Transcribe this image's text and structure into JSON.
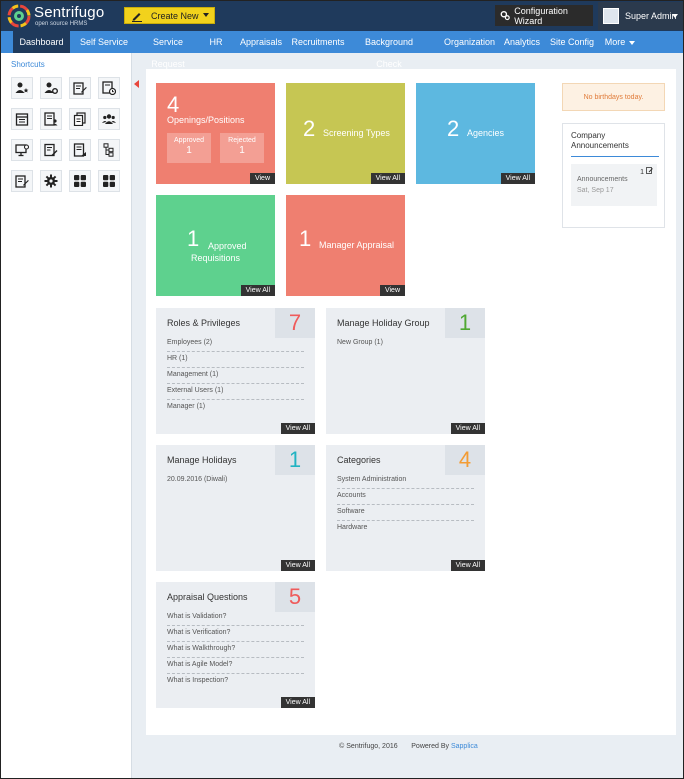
{
  "brand": {
    "name": "Sentrifugo",
    "tagline": "open source HRMS"
  },
  "topbar": {
    "create_label": "Create New",
    "config_label": "Configuration Wizard",
    "user_label": "Super Admin"
  },
  "nav": {
    "items": [
      {
        "label": "Dashboard"
      },
      {
        "label": "Self Service"
      },
      {
        "label": "Service Request"
      },
      {
        "label": "HR"
      },
      {
        "label": "Appraisals"
      },
      {
        "label": "Recruitments"
      },
      {
        "label": "Background Check"
      },
      {
        "label": "Organization"
      },
      {
        "label": "Analytics"
      },
      {
        "label": "Site Config"
      },
      {
        "label": "More"
      }
    ]
  },
  "sidebar": {
    "title": "Shortcuts",
    "icons": [
      "user-star-icon",
      "user-gear-icon",
      "edit-doc-icon",
      "doc-clock-icon",
      "calendar-list-icon",
      "doc-person-icon",
      "doc-stack-icon",
      "group-icon",
      "screen-refresh-icon",
      "doc-pen-icon",
      "doc-user-icon",
      "tree-doc-icon",
      "doc-edit-icon",
      "gear-icon",
      "grid-icon",
      "grid-icon-2"
    ]
  },
  "tiles": {
    "openings": {
      "num": "4",
      "label": "Openings/Positions",
      "approved_label": "Approved",
      "approved_value": "1",
      "rejected_label": "Rejected",
      "rejected_value": "1",
      "btn": "View"
    },
    "screening": {
      "num": "2",
      "label": "Screening Types",
      "btn": "View All"
    },
    "agencies": {
      "num": "2",
      "label": "Agencies",
      "btn": "View All"
    },
    "requisitions": {
      "num": "1",
      "label_line1": "Approved",
      "label_line2": "Requisitions",
      "btn": "View All"
    },
    "manager": {
      "num": "1",
      "label": "Manager Appraisal",
      "btn": "View"
    }
  },
  "cards": {
    "roles": {
      "title": "Roles & Privileges",
      "num": "7",
      "rows": [
        "Employees (2)",
        "HR (1)",
        "Management (1)",
        "External Users (1)",
        "Manager (1)"
      ],
      "btn": "View All"
    },
    "holiday_group": {
      "title": "Manage Holiday Group",
      "num": "1",
      "rows": [
        "New Group (1)"
      ],
      "btn": "View All"
    },
    "holidays": {
      "title": "Manage Holidays",
      "num": "1",
      "rows": [
        "20.09.2016 (Diwali)"
      ],
      "btn": "View All"
    },
    "categories": {
      "title": "Categories",
      "num": "4",
      "rows": [
        "System Administration",
        "Accounts",
        "Software",
        "Hardware"
      ],
      "btn": "View All"
    },
    "appraisal_q": {
      "title": "Appraisal Questions",
      "num": "5",
      "rows": [
        "What is Validation?",
        "What is Verification?",
        "What is Walkthrough?",
        "What is Agile Model?",
        "What is Inspection?"
      ],
      "btn": "View All"
    }
  },
  "right": {
    "birthday_text": "No birthdays today.",
    "announce_title": "Company Announcements",
    "announce_count": "1",
    "announce_name": "Announcements",
    "announce_date": "Sat, Sep 17"
  },
  "footer": {
    "copyright": "© Sentrifugo, 2016",
    "powered": "Powered By",
    "powered_link": "Sapplica"
  },
  "colors": {
    "salmon": "#ef7f70",
    "olive": "#c6c653",
    "sky": "#5db8e0",
    "green": "#5ed18e",
    "nav": "#3d8ad8",
    "dark": "#1f3a5c"
  }
}
